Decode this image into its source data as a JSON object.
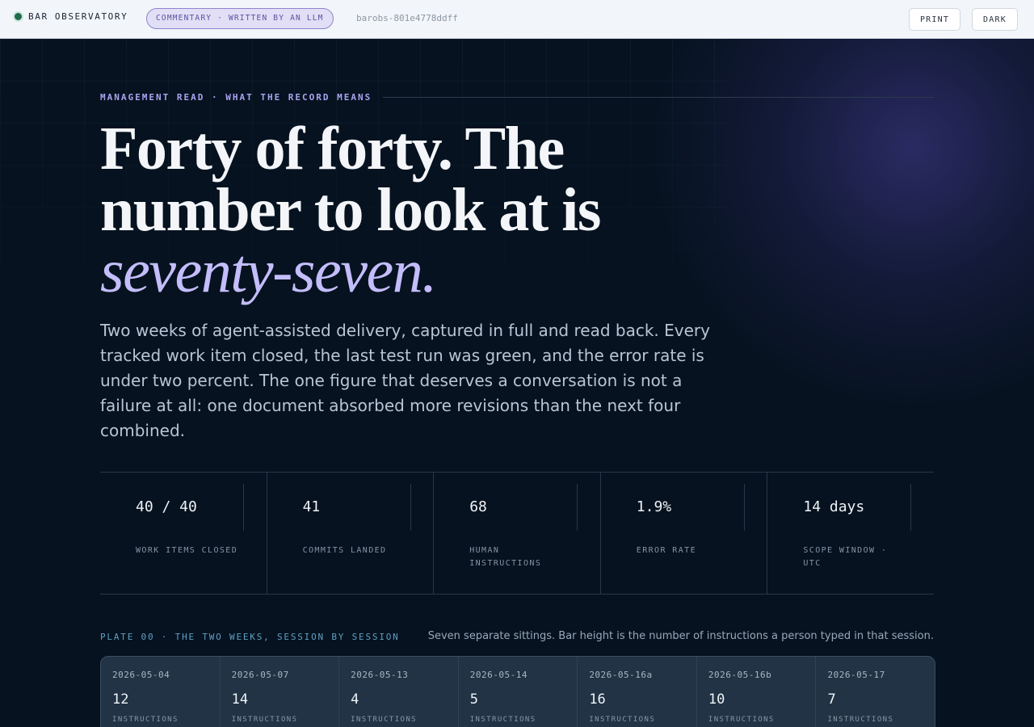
{
  "topbar": {
    "brand": "BAR OBSERVATORY",
    "badge": "COMMENTARY · WRITTEN BY AN LLM",
    "hash": "barobs-801e4778ddff",
    "print_label": "PRINT",
    "dark_label": "DARK"
  },
  "hero": {
    "eyebrow": "MANAGEMENT READ · WHAT THE RECORD MEANS",
    "headline_line1": "Forty of forty. The",
    "headline_line2": "number to look at is",
    "headline_emphasis": "seventy-seven.",
    "lede": "Two weeks of agent-assisted delivery, captured in full and read back. Every tracked work item closed, the last test run was green, and the error rate is under two percent. The one figure that deserves a conversation is not a failure at all: one document absorbed more revisions than the next four combined."
  },
  "stats": [
    {
      "value": "40 / 40",
      "label": "WORK ITEMS CLOSED"
    },
    {
      "value": "41",
      "label": "COMMITS LANDED"
    },
    {
      "value": "68",
      "label": "HUMAN INSTRUCTIONS"
    },
    {
      "value": "1.9%",
      "label": "ERROR RATE"
    },
    {
      "value": "14 days",
      "label": "SCOPE WINDOW · UTC"
    }
  ],
  "plate": {
    "heading": "PLATE 00 · THE TWO WEEKS, SESSION BY SESSION",
    "note": "Seven separate sittings. Bar height is the number of instructions a person typed in that session.",
    "unit_label": "INSTRUCTIONS",
    "sessions": [
      {
        "date": "2026-05-04",
        "count": "12"
      },
      {
        "date": "2026-05-07",
        "count": "14"
      },
      {
        "date": "2026-05-13",
        "count": "4"
      },
      {
        "date": "2026-05-14",
        "count": "5"
      },
      {
        "date": "2026-05-16a",
        "count": "16"
      },
      {
        "date": "2026-05-16b",
        "count": "10"
      },
      {
        "date": "2026-05-17",
        "count": "7"
      }
    ]
  }
}
